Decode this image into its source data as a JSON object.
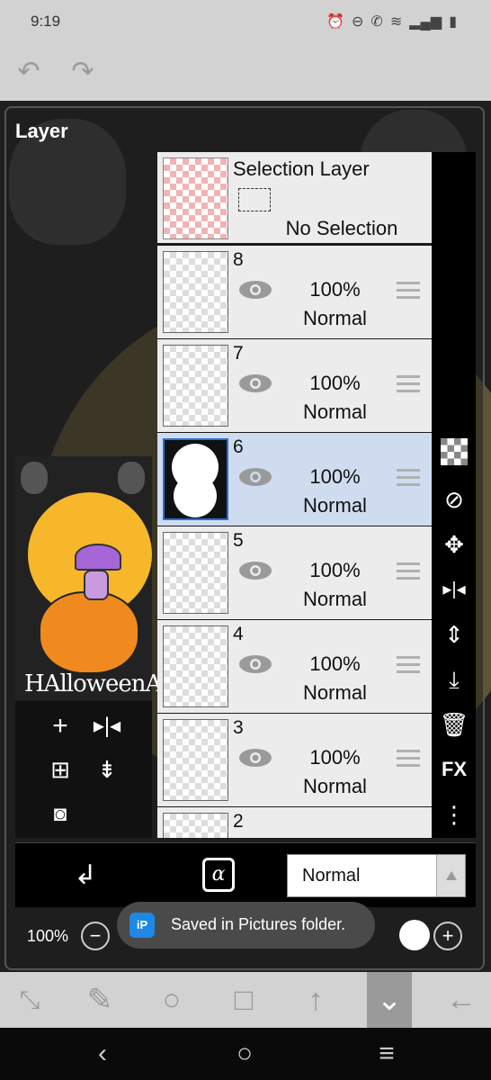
{
  "status_bar": {
    "time": "9:19",
    "icons": [
      "alarm-icon",
      "do-not-disturb-icon",
      "wifi-call-icon",
      "wifi-icon",
      "signal-icon",
      "battery-icon"
    ]
  },
  "top_bar": {
    "undo_icon": "undo-icon",
    "redo_icon": "redo-icon"
  },
  "panel": {
    "title": "Layer"
  },
  "thumbnail": {
    "caption": "HAlloweenArt"
  },
  "left_tools": [
    "add-layer-icon",
    "flip-horizontal-icon",
    "duplicate-layer-icon",
    "merge-down-icon",
    "camera-icon"
  ],
  "selection_layer": {
    "title": "Selection Layer",
    "status": "No Selection"
  },
  "layers": [
    {
      "number": "8",
      "opacity": "100%",
      "mode": "Normal",
      "selected": false
    },
    {
      "number": "7",
      "opacity": "100%",
      "mode": "Normal",
      "selected": false
    },
    {
      "number": "6",
      "opacity": "100%",
      "mode": "Normal",
      "selected": true
    },
    {
      "number": "5",
      "opacity": "100%",
      "mode": "Normal",
      "selected": false
    },
    {
      "number": "4",
      "opacity": "100%",
      "mode": "Normal",
      "selected": false
    },
    {
      "number": "3",
      "opacity": "100%",
      "mode": "Normal",
      "selected": false
    },
    {
      "number": "2"
    }
  ],
  "right_tools": {
    "fx_label": "FX",
    "icons": [
      "transparency-grid-icon",
      "clipping-icon",
      "move-icon",
      "flip-horizontal-icon",
      "flip-vertical-icon",
      "merge-down-icon",
      "trash-icon",
      "more-icon"
    ]
  },
  "blend_bar": {
    "mode": "Normal",
    "alpha_lock_label": "α"
  },
  "zoom": {
    "label": "100%",
    "minus": "−",
    "plus": "+"
  },
  "toast": {
    "text": "Saved in Pictures folder.",
    "icon_label": "iP"
  },
  "bottom_toolbar": [
    "transform-icon",
    "brush-icon",
    "ellipse-icon",
    "rectangle-icon",
    "arrow-up-icon",
    "collapse-icon",
    "back-arrow-icon"
  ],
  "nav_bar": [
    "back-nav-icon",
    "home-nav-icon",
    "recents-nav-icon"
  ]
}
